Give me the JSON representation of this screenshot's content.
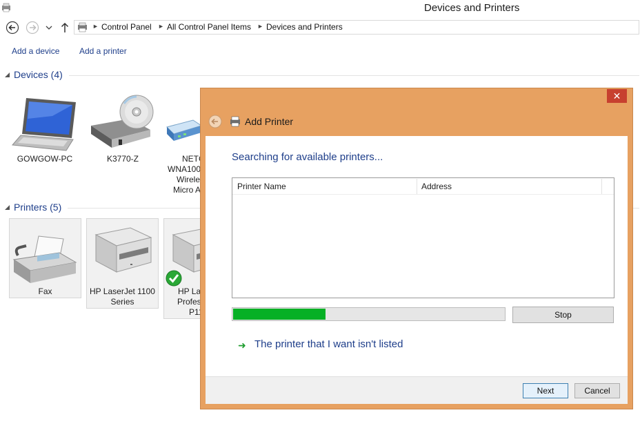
{
  "window": {
    "title": "Devices and Printers"
  },
  "address": {
    "crumbs": [
      "Control Panel",
      "All Control Panel Items",
      "Devices and Printers"
    ]
  },
  "commands": {
    "add_device": "Add a device",
    "add_printer": "Add a printer"
  },
  "devices": {
    "header": "Devices (4)",
    "items": [
      {
        "label": "GOWGOW-PC"
      },
      {
        "label": "K3770-Z"
      },
      {
        "label_lines": [
          "NETG",
          "WNA100",
          "Wirele",
          "Micro A"
        ]
      }
    ]
  },
  "printers": {
    "header": "Printers (5)",
    "items": [
      {
        "label_lines": [
          "Fax"
        ]
      },
      {
        "label_lines": [
          "HP LaserJet 1100",
          "Series"
        ]
      },
      {
        "label_lines": [
          "HP La",
          "Profes",
          "P11"
        ]
      }
    ]
  },
  "dialog": {
    "title": "Add Printer",
    "close_glyph": "✕",
    "heading": "Searching for available printers...",
    "columns": [
      "Printer Name",
      "Address"
    ],
    "progress_fraction": 0.34,
    "stop_label": "Stop",
    "not_listed": "The printer that I want isn't listed",
    "next_label": "Next",
    "cancel_label": "Cancel"
  },
  "colors": {
    "accent_text": "#1e3e8a",
    "dialog_frame": "#e7a161",
    "progress": "#06b025"
  }
}
